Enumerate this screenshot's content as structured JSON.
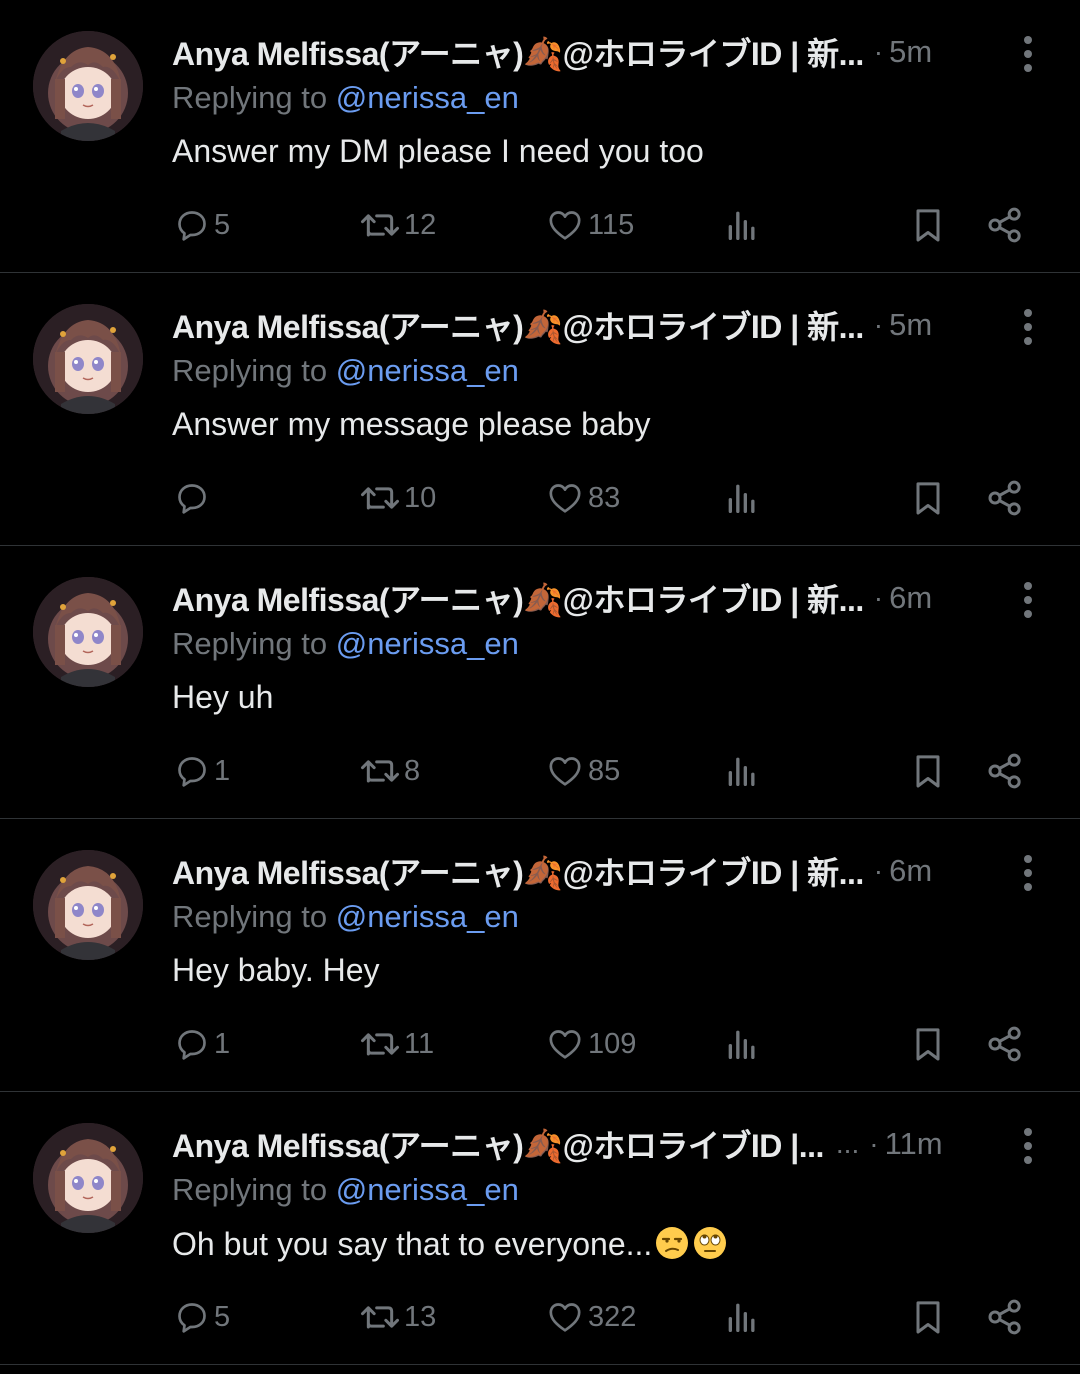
{
  "colors": {
    "background": "#000000",
    "text": "#e7e9ea",
    "secondary": "#71767b",
    "link": "#6b9cf0",
    "divider": "#2f3336"
  },
  "tweets": [
    {
      "name": "Anya Melfissa(アーニャ)🍂@ホロライブID | 新...",
      "extra": "",
      "time": "5m",
      "reply_prefix": "Replying to ",
      "reply_handle": "@nerissa_en",
      "text": "Answer my DM please I need you too",
      "emojis": [],
      "replies": "5",
      "reposts": "12",
      "likes": "115"
    },
    {
      "name": "Anya Melfissa(アーニャ)🍂@ホロライブID | 新...",
      "extra": "",
      "time": "5m",
      "reply_prefix": "Replying to ",
      "reply_handle": "@nerissa_en",
      "text": "Answer my message please baby",
      "emojis": [],
      "replies": "",
      "reposts": "10",
      "likes": "83"
    },
    {
      "name": "Anya Melfissa(アーニャ)🍂@ホロライブID | 新...",
      "extra": "",
      "time": "6m",
      "reply_prefix": "Replying to ",
      "reply_handle": "@nerissa_en",
      "text": "Hey uh",
      "emojis": [],
      "replies": "1",
      "reposts": "8",
      "likes": "85"
    },
    {
      "name": "Anya Melfissa(アーニャ)🍂@ホロライブID | 新...",
      "extra": "",
      "time": "6m",
      "reply_prefix": "Replying to ",
      "reply_handle": "@nerissa_en",
      "text": "Hey baby. Hey",
      "emojis": [],
      "replies": "1",
      "reposts": "11",
      "likes": "109"
    },
    {
      "name": "Anya Melfissa(アーニャ)🍂@ホロライブID |...",
      "extra": "...",
      "time": "11m",
      "reply_prefix": "Replying to ",
      "reply_handle": "@nerissa_en",
      "text": "Oh but you say that to everyone...",
      "emojis": [
        "unamused-face-emoji",
        "face-with-rolling-eyes-emoji"
      ],
      "replies": "5",
      "reposts": "13",
      "likes": "322"
    }
  ]
}
